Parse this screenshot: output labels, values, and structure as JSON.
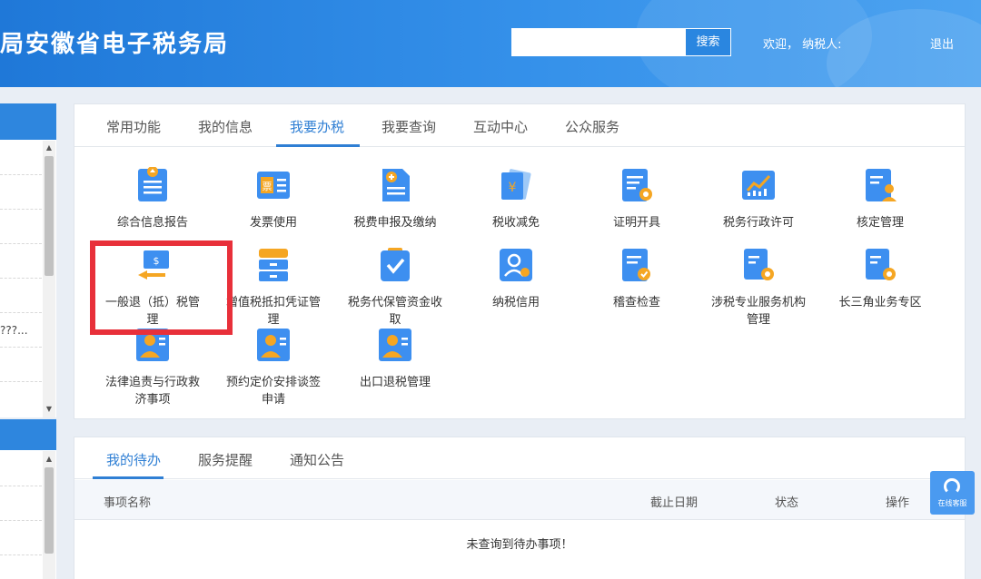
{
  "header": {
    "site_title": "局安徽省电子税务局",
    "search_placeholder": "",
    "search_button": "搜索",
    "welcome": "欢迎， 纳税人:",
    "logout": "退出"
  },
  "sidebar": {
    "truncated_text": "???..."
  },
  "main_tabs": [
    {
      "label": "常用功能",
      "active": false
    },
    {
      "label": "我的信息",
      "active": false
    },
    {
      "label": "我要办税",
      "active": true
    },
    {
      "label": "我要查询",
      "active": false
    },
    {
      "label": "互动中心",
      "active": false
    },
    {
      "label": "公众服务",
      "active": false
    }
  ],
  "services": [
    {
      "label": "综合信息报告",
      "icon": "report-upload-icon"
    },
    {
      "label": "发票使用",
      "icon": "invoice-icon"
    },
    {
      "label": "税费申报及缴纳",
      "icon": "tax-declare-icon"
    },
    {
      "label": "税收减免",
      "icon": "tax-relief-icon"
    },
    {
      "label": "证明开具",
      "icon": "certificate-icon"
    },
    {
      "label": "税务行政许可",
      "icon": "admin-license-icon"
    },
    {
      "label": "核定管理",
      "icon": "approval-management-icon"
    },
    {
      "label": "一般退（抵）税管理",
      "icon": "tax-refund-icon"
    },
    {
      "label": "增值税抵扣凭证管理",
      "icon": "vat-deduction-icon"
    },
    {
      "label": "税务代保管资金收取",
      "icon": "fund-custody-icon"
    },
    {
      "label": "纳税信用",
      "icon": "tax-credit-icon"
    },
    {
      "label": "稽查检查",
      "icon": "inspection-icon"
    },
    {
      "label": "涉税专业服务机构管理",
      "icon": "agency-management-icon"
    },
    {
      "label": "长三角业务专区",
      "icon": "yangtze-delta-icon"
    },
    {
      "label": "法律追责与行政救济事项",
      "icon": "legal-remedy-icon"
    },
    {
      "label": "预约定价安排谈签申请",
      "icon": "pricing-arrangement-icon"
    },
    {
      "label": "出口退税管理",
      "icon": "export-refund-icon"
    }
  ],
  "service_label_lines": {
    "s7": [
      "一般退（抵）税管",
      "理"
    ],
    "s8": [
      "增值税抵扣凭证管",
      "理"
    ],
    "s9": [
      "税务代保管资金收",
      "取"
    ],
    "s12": [
      "涉税专业服务机构",
      "管理"
    ],
    "s14": [
      "法律追责与行政救",
      "济事项"
    ],
    "s15": [
      "预约定价安排谈签",
      "申请"
    ]
  },
  "bottom_tabs": [
    {
      "label": "我的待办",
      "active": true
    },
    {
      "label": "服务提醒",
      "active": false
    },
    {
      "label": "通知公告",
      "active": false
    }
  ],
  "table_headers": {
    "name": "事项名称",
    "deadline": "截止日期",
    "status": "状态",
    "action": "操作"
  },
  "empty_message": "未查询到待办事项！",
  "float_service": "在线客服",
  "colors": {
    "header_blue": "#2a86e0",
    "accent": "#2f7fd4",
    "highlight_red": "#e8303a",
    "icon_blue": "#3d8ff0",
    "icon_orange": "#f5a623"
  }
}
